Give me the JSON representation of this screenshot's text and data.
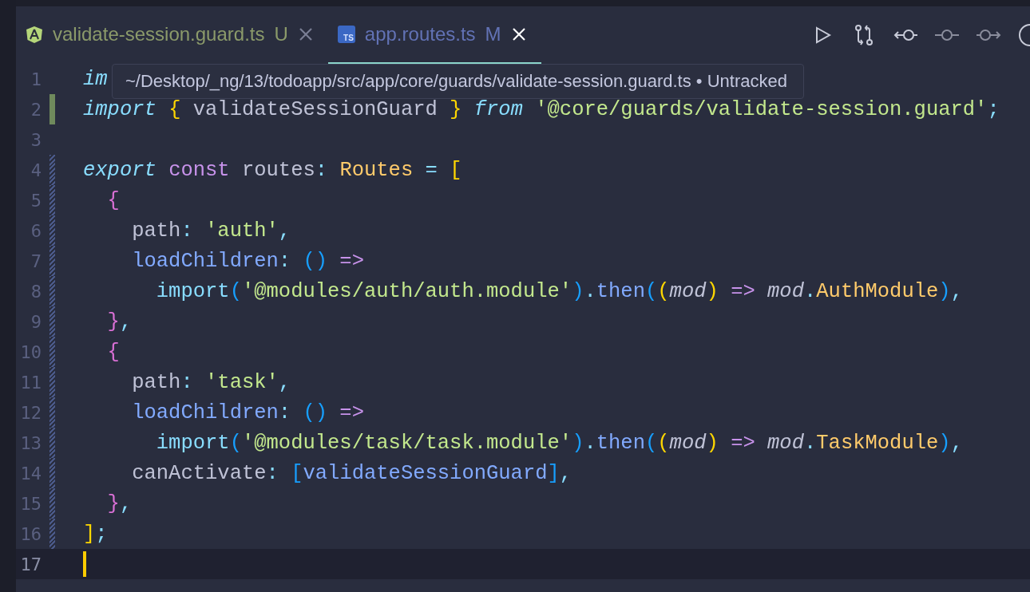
{
  "tabs": [
    {
      "kind": "angular",
      "label": "validate-session.guard.ts",
      "status": "U",
      "color": "#8b9a6a",
      "selected": false
    },
    {
      "kind": "typescript",
      "icon_label": "TS",
      "label": "app.routes.ts",
      "status": "M",
      "color": "#6272b5",
      "selected": true
    }
  ],
  "tooltip": {
    "text": "~/Desktop/_ng/13/todoapp/src/app/core/guards/validate-session.guard.ts • Untracked"
  },
  "lines": [
    {
      "number": "1",
      "modified": false,
      "added": false,
      "current": false,
      "tokens": [
        {
          "text": "im",
          "kind": "kw"
        }
      ]
    },
    {
      "number": "2",
      "modified": true,
      "added": false,
      "current": false,
      "tokens": [
        {
          "text": "import",
          "kind": "kw"
        },
        {
          "text": " {",
          "kind": "b1"
        },
        {
          "text": " validateSessionGuard",
          "kind": "var"
        },
        {
          "text": " }",
          "kind": "b1"
        },
        {
          "text": " from",
          "kind": "kw"
        },
        {
          "text": " '@core/guards/validate-session.guard'",
          "kind": "str"
        },
        {
          "text": ";",
          "kind": "op"
        }
      ]
    },
    {
      "number": "3",
      "modified": false,
      "added": false,
      "current": false
    },
    {
      "number": "4",
      "modified": false,
      "added": true,
      "current": false,
      "tokens": [
        {
          "text": "export",
          "kind": "kw"
        },
        {
          "text": " const",
          "kind": "storage"
        },
        {
          "text": " routes",
          "kind": "var"
        },
        {
          "text": ": ",
          "kind": "op"
        },
        {
          "text": "Routes",
          "kind": "type"
        },
        {
          "text": " = ",
          "kind": "op"
        },
        {
          "text": "[",
          "kind": "b1"
        }
      ]
    },
    {
      "number": "5",
      "modified": false,
      "added": true,
      "current": false,
      "tokens": [
        {
          "text": "  {",
          "kind": "b2"
        }
      ]
    },
    {
      "number": "6",
      "modified": false,
      "added": true,
      "current": false,
      "tokens": [
        {
          "text": "    path",
          "kind": "var"
        },
        {
          "text": ": ",
          "kind": "op"
        },
        {
          "text": "'auth'",
          "kind": "str"
        },
        {
          "text": ",",
          "kind": "op"
        }
      ]
    },
    {
      "number": "7",
      "modified": false,
      "added": true,
      "current": false,
      "tokens": [
        {
          "text": "    loadChildren",
          "kind": "fn"
        },
        {
          "text": ": ",
          "kind": "op"
        },
        {
          "text": "()",
          "kind": "b3"
        },
        {
          "text": " =>",
          "kind": "storage"
        }
      ]
    },
    {
      "number": "8",
      "modified": false,
      "added": true,
      "current": false,
      "tokens": [
        {
          "text": "      import",
          "kind": "op"
        },
        {
          "text": "(",
          "kind": "b3"
        },
        {
          "text": "'@modules/auth/auth.module'",
          "kind": "str"
        },
        {
          "text": ")",
          "kind": "b3"
        },
        {
          "text": ".",
          "kind": "op"
        },
        {
          "text": "then",
          "kind": "fn"
        },
        {
          "text": "(",
          "kind": "b3"
        },
        {
          "text": "(",
          "kind": "b1"
        },
        {
          "text": "mod",
          "kind": "param"
        },
        {
          "text": ")",
          "kind": "b1"
        },
        {
          "text": " => ",
          "kind": "storage"
        },
        {
          "text": "mod",
          "kind": "param"
        },
        {
          "text": ".",
          "kind": "op"
        },
        {
          "text": "AuthModule",
          "kind": "type"
        },
        {
          "text": ")",
          "kind": "b3"
        },
        {
          "text": ",",
          "kind": "op"
        }
      ]
    },
    {
      "number": "9",
      "modified": false,
      "added": true,
      "current": false,
      "tokens": [
        {
          "text": "  }",
          "kind": "b2"
        },
        {
          "text": ",",
          "kind": "op"
        }
      ]
    },
    {
      "number": "10",
      "modified": false,
      "added": true,
      "current": false,
      "tokens": [
        {
          "text": "  {",
          "kind": "b2"
        }
      ]
    },
    {
      "number": "11",
      "modified": false,
      "added": true,
      "current": false,
      "tokens": [
        {
          "text": "    path",
          "kind": "var"
        },
        {
          "text": ": ",
          "kind": "op"
        },
        {
          "text": "'task'",
          "kind": "str"
        },
        {
          "text": ",",
          "kind": "op"
        }
      ]
    },
    {
      "number": "12",
      "modified": false,
      "added": true,
      "current": false,
      "tokens": [
        {
          "text": "    loadChildren",
          "kind": "fn"
        },
        {
          "text": ": ",
          "kind": "op"
        },
        {
          "text": "()",
          "kind": "b3"
        },
        {
          "text": " =>",
          "kind": "storage"
        }
      ]
    },
    {
      "number": "13",
      "modified": false,
      "added": true,
      "current": false,
      "tokens": [
        {
          "text": "      import",
          "kind": "op"
        },
        {
          "text": "(",
          "kind": "b3"
        },
        {
          "text": "'@modules/task/task.module'",
          "kind": "str"
        },
        {
          "text": ")",
          "kind": "b3"
        },
        {
          "text": ".",
          "kind": "op"
        },
        {
          "text": "then",
          "kind": "fn"
        },
        {
          "text": "(",
          "kind": "b3"
        },
        {
          "text": "(",
          "kind": "b1"
        },
        {
          "text": "mod",
          "kind": "param"
        },
        {
          "text": ")",
          "kind": "b1"
        },
        {
          "text": " => ",
          "kind": "storage"
        },
        {
          "text": "mod",
          "kind": "param"
        },
        {
          "text": ".",
          "kind": "op"
        },
        {
          "text": "TaskModule",
          "kind": "type"
        },
        {
          "text": ")",
          "kind": "b3"
        },
        {
          "text": ",",
          "kind": "op"
        }
      ]
    },
    {
      "number": "14",
      "modified": false,
      "added": true,
      "current": false,
      "tokens": [
        {
          "text": "    canActivate",
          "kind": "var"
        },
        {
          "text": ": ",
          "kind": "op"
        },
        {
          "text": "[",
          "kind": "b3"
        },
        {
          "text": "validateSessionGuard",
          "kind": "fn"
        },
        {
          "text": "]",
          "kind": "b3"
        },
        {
          "text": ",",
          "kind": "op"
        }
      ]
    },
    {
      "number": "15",
      "modified": false,
      "added": true,
      "current": false,
      "tokens": [
        {
          "text": "  }",
          "kind": "b2"
        },
        {
          "text": ",",
          "kind": "op"
        }
      ]
    },
    {
      "number": "16",
      "modified": false,
      "added": true,
      "current": false,
      "tokens": [
        {
          "text": "]",
          "kind": "b1"
        },
        {
          "text": ";",
          "kind": "op"
        }
      ]
    },
    {
      "number": "17",
      "modified": false,
      "added": false,
      "current": true
    }
  ]
}
